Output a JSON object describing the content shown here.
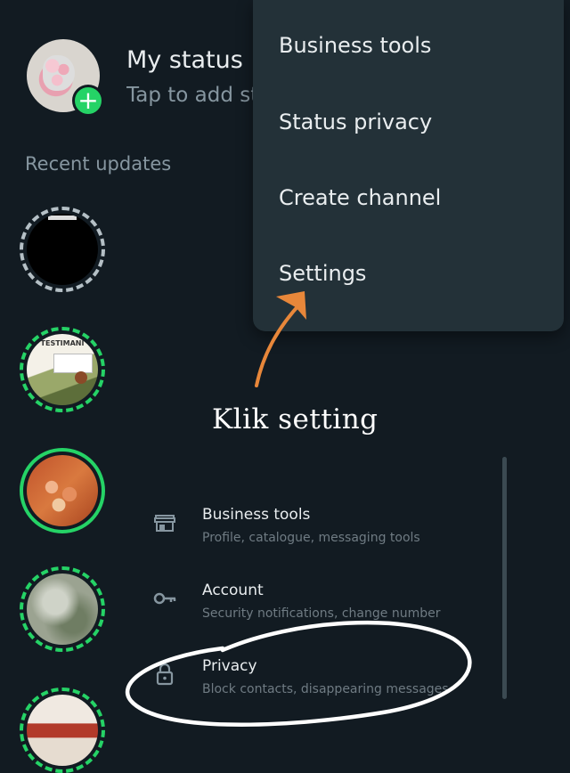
{
  "my_status": {
    "title": "My status",
    "subtitle": "Tap to add status update"
  },
  "recent_updates_label": "Recent updates",
  "statuses": [
    {
      "ring": "dashed",
      "thumb_text": ""
    },
    {
      "ring": "dashed-green",
      "thumb_text": "TESTIMANI"
    },
    {
      "ring": "solid-green",
      "thumb_text": ""
    },
    {
      "ring": "dashed-green",
      "thumb_text": ""
    },
    {
      "ring": "dashed-green",
      "thumb_text": ""
    }
  ],
  "menu": {
    "items": [
      "Business tools",
      "Status privacy",
      "Create channel",
      "Settings"
    ]
  },
  "annotation": {
    "text": "Klik setting"
  },
  "settings": [
    {
      "icon": "store-icon",
      "title": "Business tools",
      "subtitle": "Profile, catalogue, messaging tools"
    },
    {
      "icon": "key-icon",
      "title": "Account",
      "subtitle": "Security notifications, change number"
    },
    {
      "icon": "lock-icon",
      "title": "Privacy",
      "subtitle": "Block contacts, disappearing messages"
    }
  ],
  "colors": {
    "background": "#121b22",
    "menu_bg": "#233138",
    "accent_green": "#25d366",
    "arrow_orange": "#e8873a",
    "circle_white": "#ffffff"
  }
}
